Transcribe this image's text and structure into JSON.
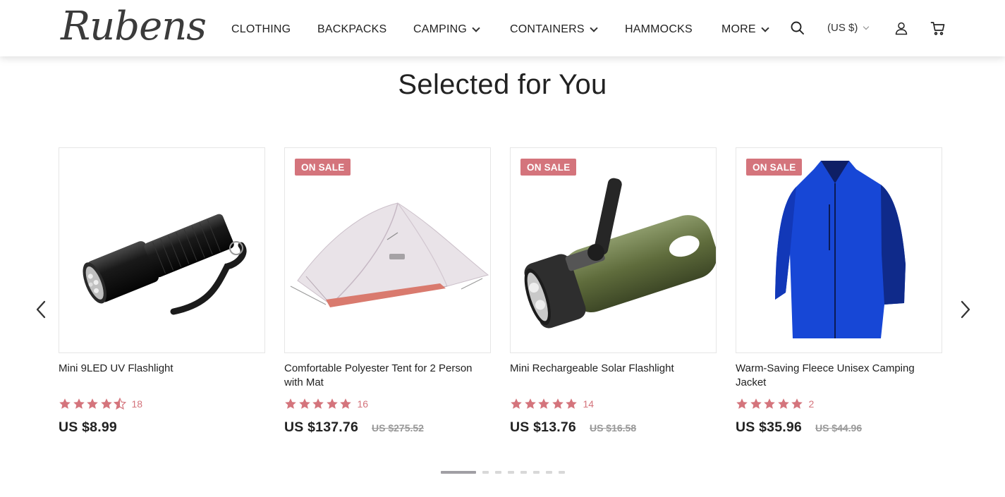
{
  "brand": {
    "logo_text": "Rubens"
  },
  "nav": {
    "items": [
      {
        "label": "CLOTHING",
        "has_dropdown": false
      },
      {
        "label": "BACKPACKS",
        "has_dropdown": false
      },
      {
        "label": "CAMPING",
        "has_dropdown": true
      },
      {
        "label": "CONTAINERS",
        "has_dropdown": true
      },
      {
        "label": "HAMMOCKS",
        "has_dropdown": false
      },
      {
        "label": "MORE",
        "has_dropdown": true
      }
    ],
    "currency": "(US $)",
    "icons": [
      "search-icon",
      "user-icon",
      "cart-icon"
    ]
  },
  "section": {
    "title": "Selected for You"
  },
  "products": [
    {
      "name": "Mini 9LED UV Flashlight",
      "badge": "",
      "rating": 4.5,
      "reviews": "18",
      "price": "US $8.99",
      "old_price": "",
      "image_icon": "flashlight-image"
    },
    {
      "name": "Comfortable Polyester Tent for 2 Person with Mat",
      "badge": "ON SALE",
      "rating": 5,
      "reviews": "16",
      "price": "US $137.76",
      "old_price": "US $275.52",
      "image_icon": "tent-image"
    },
    {
      "name": "Mini Rechargeable Solar Flashlight",
      "badge": "ON SALE",
      "rating": 5,
      "reviews": "14",
      "price": "US $13.76",
      "old_price": "US $16.58",
      "image_icon": "solar-flashlight-image"
    },
    {
      "name": "Warm-Saving Fleece Unisex Camping Jacket",
      "badge": "ON SALE",
      "rating": 5,
      "reviews": "2",
      "price": "US $35.96",
      "old_price": "US $44.96",
      "image_icon": "jacket-image"
    }
  ],
  "carousel": {
    "page_count": 8,
    "active_page": 1
  },
  "colors": {
    "accent": "#d4747c",
    "text": "#222222",
    "dot_active": "#a09fa4",
    "dot_inactive": "#d8d8d8"
  }
}
